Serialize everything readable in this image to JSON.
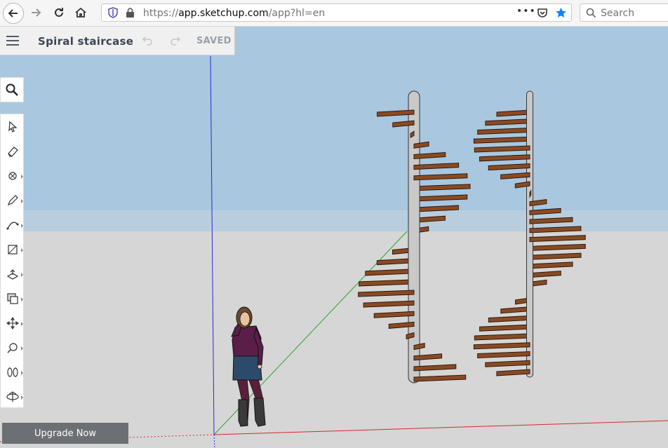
{
  "browser": {
    "url_scheme": "https://",
    "url_host": "app.sketchup.com",
    "url_path": "/app?hl=en",
    "search_placeholder": "Search",
    "menu_dots": "•••"
  },
  "app": {
    "model_title": "Spiral staircase",
    "save_status": "SAVED",
    "upgrade_label": "Upgrade Now"
  },
  "tools": [
    "select-icon",
    "eraser-icon",
    "paint-bucket-icon",
    "pencil-icon",
    "arc-icon",
    "rectangle-icon",
    "push-pull-icon",
    "offset-icon",
    "move-icon",
    "tape-measure-icon",
    "walk-icon",
    "orbit-icon"
  ],
  "colors": {
    "sky": "#a9c7df",
    "ground": "#d6d6d6",
    "wood": "#8a4a22",
    "pole": "#c9c9c9",
    "axis_red": "#d42a2a",
    "axis_green": "#2aa52a",
    "axis_blue": "#2a2ad4"
  }
}
